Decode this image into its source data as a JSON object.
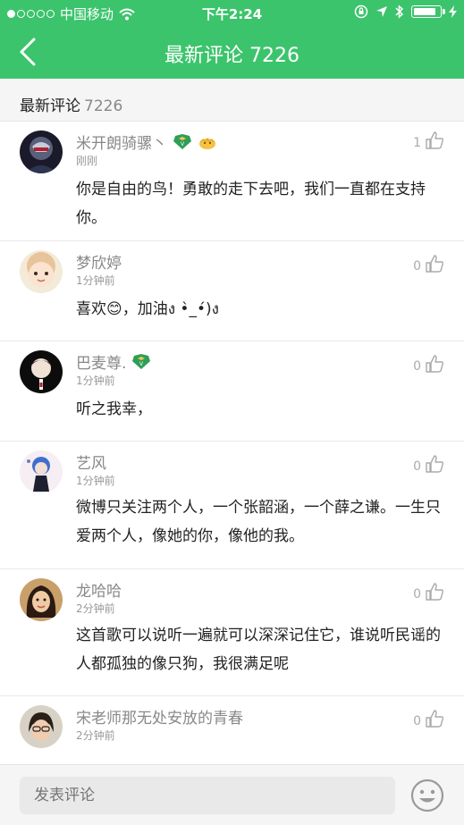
{
  "status": {
    "carrier": "中国移动",
    "time": "下午2:24",
    "signal_filled": 1,
    "signal_total": 5,
    "battery_level": 0.85
  },
  "nav": {
    "title": "最新评论 7226"
  },
  "section": {
    "label": "最新评论",
    "count": "7226"
  },
  "comments": [
    {
      "name": "米开朗骑骡丶",
      "time": "刚刚",
      "likes": "1",
      "text": "你是自由的鸟！勇敢的走下去吧，我们一直都在支持你。",
      "badges": [
        "vip-badge-icon",
        "hatch-chick-badge-icon"
      ]
    },
    {
      "name": "梦欣婷",
      "time": "1分钟前",
      "likes": "0",
      "text": "喜欢😊，加油ง •̀_•́)ง",
      "badges": []
    },
    {
      "name": "巴麦尊.",
      "time": "1分钟前",
      "likes": "0",
      "text": "听之我幸，",
      "badges": [
        "vip-badge-icon"
      ]
    },
    {
      "name": "艺风",
      "time": "1分钟前",
      "likes": "0",
      "text": "微博只关注两个人，一个张韶涵，一个薛之谦。一生只爱两个人，像她的你，像他的我。",
      "badges": []
    },
    {
      "name": "龙哈哈",
      "time": "2分钟前",
      "likes": "0",
      "text": "这首歌可以说听一遍就可以深深记住它，谁说听民谣的人都孤独的像只狗，我很满足呢",
      "badges": []
    },
    {
      "name": "宋老师那无处安放的青春",
      "time": "2分钟前",
      "likes": "0",
      "text": "",
      "badges": []
    }
  ],
  "composer": {
    "placeholder": "发表评论"
  },
  "colors": {
    "brand": "#3cc46c"
  }
}
